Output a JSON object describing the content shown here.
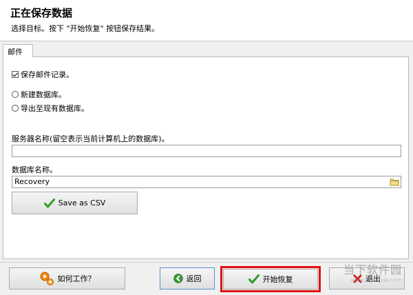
{
  "header": {
    "title": "正在保存数据",
    "subtitle": "选择目标。按下 \"开始恢复\" 按钮保存结果。"
  },
  "tab": {
    "label": "邮件"
  },
  "options": {
    "save_mail_records": "保存邮件记录。",
    "save_mail_records_checked": true,
    "new_database": "新建数据库。",
    "export_existing": "导出至现有数据库。"
  },
  "server": {
    "label": "服务器名称(留空表示当前计算机上的数据库)。",
    "value": ""
  },
  "database": {
    "label": "数据库名称。",
    "value": "Recovery"
  },
  "buttons": {
    "save_csv": "Save as CSV",
    "how_it_works": "如何工作？",
    "back": "返回",
    "start_recovery": "开始恢复",
    "exit": "退出"
  },
  "watermark": {
    "text": "当下软件园",
    "url": "www.downxia.com"
  },
  "colors": {
    "highlight": "#e01010",
    "check_green": "#2aa02a",
    "exit_red": "#d42020",
    "gear_orange": "#f08a10"
  }
}
